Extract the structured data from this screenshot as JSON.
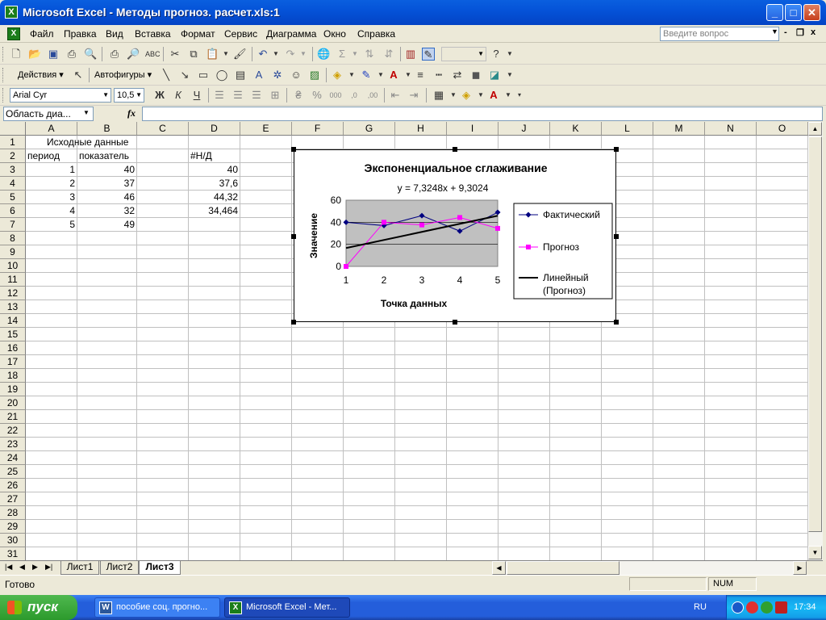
{
  "window": {
    "title": "Microsoft Excel - Методы прогноз. расчет.xls:1",
    "app_icon": "X",
    "minimize": "_",
    "maximize": "□",
    "close": "✕"
  },
  "menubar": {
    "items": [
      "Файл",
      "Правка",
      "Вид",
      "Вставка",
      "Формат",
      "Сервис",
      "Диаграмма",
      "Окно",
      "Справка"
    ],
    "help_placeholder": "Введите вопрос",
    "min": "-",
    "restore": "❐",
    "close": "x"
  },
  "drawing_toolbar": {
    "actions": "Действия ▾",
    "autoshapes": "Автофигуры ▾"
  },
  "format_toolbar": {
    "font": "Arial Cyr",
    "size": "10,5",
    "bold": "Ж",
    "italic": "К",
    "underline": "Ч"
  },
  "formula_bar": {
    "name_box": "Область диа...",
    "fx": "fx",
    "content": ""
  },
  "columns": [
    "A",
    "B",
    "C",
    "D",
    "E",
    "F",
    "G",
    "H",
    "I",
    "J",
    "K",
    "L",
    "M",
    "N",
    "O"
  ],
  "rows": [
    "1",
    "2",
    "3",
    "4",
    "5",
    "6",
    "7",
    "8",
    "9",
    "10",
    "11",
    "12",
    "13",
    "14",
    "15",
    "16",
    "17",
    "18",
    "19",
    "20",
    "21",
    "22",
    "23",
    "24",
    "25",
    "26",
    "27",
    "28",
    "29",
    "30",
    "31"
  ],
  "cells": {
    "A1": "Исходные данные",
    "A2": "период",
    "B2": "показатель",
    "D2": "#Н/Д",
    "A3": "1",
    "B3": "40",
    "D3": "40",
    "A4": "2",
    "B4": "37",
    "D4": "37,6",
    "A5": "3",
    "B5": "46",
    "D5": "44,32",
    "A6": "4",
    "B6": "32",
    "D6": "34,464",
    "A7": "5",
    "B7": "49"
  },
  "chart_data": {
    "type": "line",
    "title": "Экспоненциальное сглаживание",
    "trend_equation": "y = 7,3248x + 9,3024",
    "xlabel": "Точка данных",
    "ylabel": "Значение",
    "categories": [
      "1",
      "2",
      "3",
      "4",
      "5"
    ],
    "ylim": [
      0,
      60
    ],
    "yticks": [
      "0",
      "20",
      "40",
      "60"
    ],
    "plot_bg": "#c0c0c0",
    "legend_position": "right",
    "series": [
      {
        "name": "Фактический",
        "values": [
          40,
          37,
          46,
          32,
          49
        ],
        "color": "#000080",
        "marker": "diamond"
      },
      {
        "name": "Прогноз",
        "values": [
          0,
          40,
          37.6,
          44.32,
          34.464
        ],
        "color": "#ff00ff",
        "marker": "square"
      },
      {
        "name": "Линейный (Прогноз)",
        "name_lines": [
          "Линейный",
          "(Прогноз)"
        ],
        "trend": {
          "slope": 7.3248,
          "intercept": 9.3024
        },
        "color": "#000000"
      }
    ]
  },
  "sheet_tabs": {
    "tabs": [
      "Лист1",
      "Лист2",
      "Лист3"
    ],
    "active": "Лист3"
  },
  "status": {
    "text": "Готово",
    "num": "NUM"
  },
  "taskbar": {
    "start": "пуск",
    "items": [
      {
        "label": "пособие соц. прогно...",
        "icon": "W"
      },
      {
        "label": "Microsoft Excel - Мет...",
        "icon": "X"
      }
    ],
    "lang": "RU",
    "clock": "17:34"
  }
}
